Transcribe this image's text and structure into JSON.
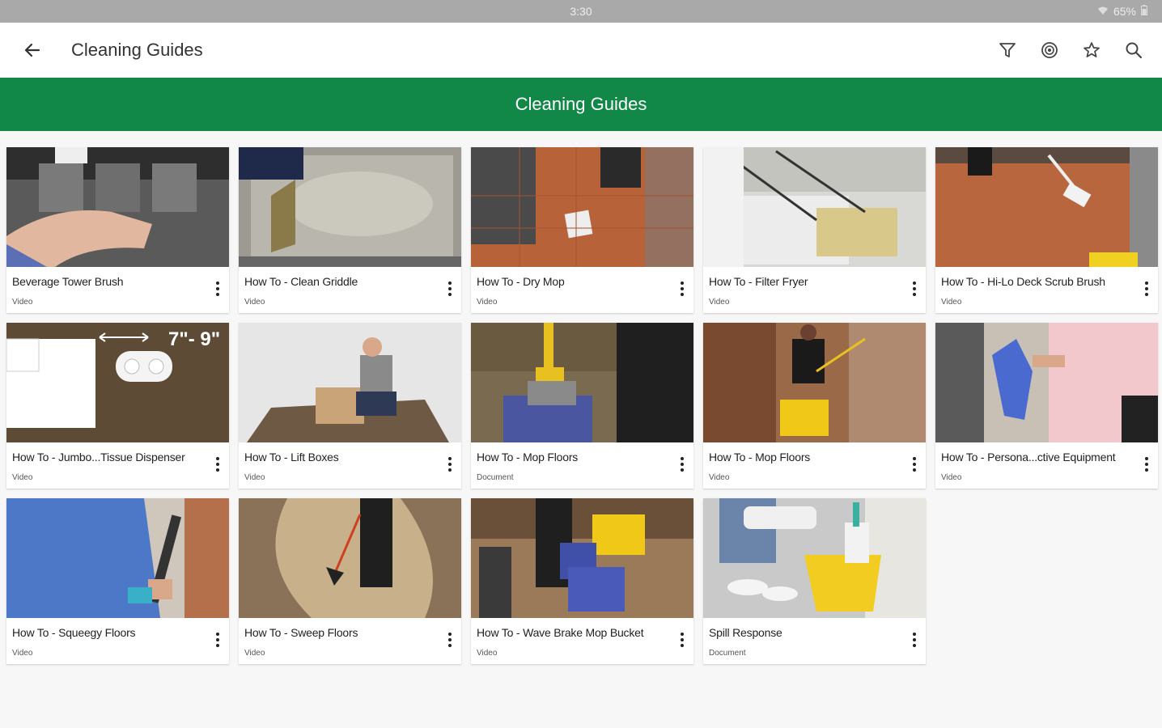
{
  "status": {
    "time": "3:30",
    "battery": "65%"
  },
  "appbar": {
    "title": "Cleaning Guides"
  },
  "banner": {
    "title": "Cleaning Guides"
  },
  "icons": {
    "back": "arrow-left-icon",
    "filter": "filter-icon",
    "target": "target-icon",
    "favorite": "star-icon",
    "search": "search-icon"
  },
  "colors": {
    "accent": "#118847"
  },
  "items": [
    {
      "title": "Beverage Tower Brush",
      "type": "Video"
    },
    {
      "title": "How To - Clean Griddle",
      "type": "Video"
    },
    {
      "title": "How To - Dry Mop",
      "type": "Video"
    },
    {
      "title": "How To - Filter Fryer",
      "type": "Video"
    },
    {
      "title": "How To - Hi-Lo Deck Scrub Brush",
      "type": "Video"
    },
    {
      "title": "How To - Jumbo...Tissue Dispenser",
      "type": "Video"
    },
    {
      "title": "How To - Lift Boxes",
      "type": "Video"
    },
    {
      "title": "How To - Mop Floors",
      "type": "Document"
    },
    {
      "title": "How To - Mop Floors",
      "type": "Video"
    },
    {
      "title": "How To - Persona...ctive Equipment",
      "type": "Video"
    },
    {
      "title": "How To - Squeegy Floors",
      "type": "Video"
    },
    {
      "title": "How To - Sweep Floors",
      "type": "Video"
    },
    {
      "title": "How To - Wave Brake Mop Bucket",
      "type": "Video"
    },
    {
      "title": "Spill Response",
      "type": "Document"
    }
  ],
  "thumbnail_labels": {
    "dispenser_measure": "7\"- 9\""
  }
}
